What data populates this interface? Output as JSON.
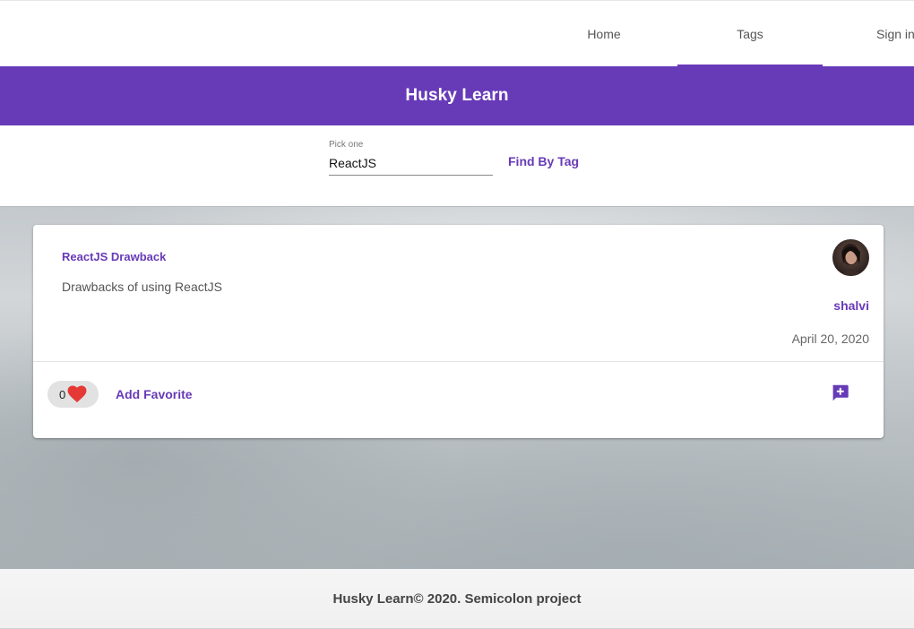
{
  "nav": {
    "items": [
      {
        "label": "Home"
      },
      {
        "label": "Tags"
      },
      {
        "label": "Sign in"
      }
    ],
    "active": "Tags"
  },
  "banner": {
    "title": "Husky Learn"
  },
  "search": {
    "label": "Pick one",
    "value": "ReactJS",
    "button_label": "Find By Tag"
  },
  "post": {
    "title": "ReactJS Drawback",
    "description": "Drawbacks of using ReactJS",
    "author": "shalvi",
    "date": "April 20, 2020",
    "likes": "0",
    "favorite_label": "Add Favorite"
  },
  "footer": {
    "text": "Husky Learn© 2020. Semicolon project"
  },
  "colors": {
    "primary": "#673ab7",
    "heart": "#e53935",
    "footer_bg": "#f5f5f5"
  },
  "icons": {
    "like": "heart-icon",
    "comment": "add-comment-icon",
    "avatar": "user-avatar"
  }
}
